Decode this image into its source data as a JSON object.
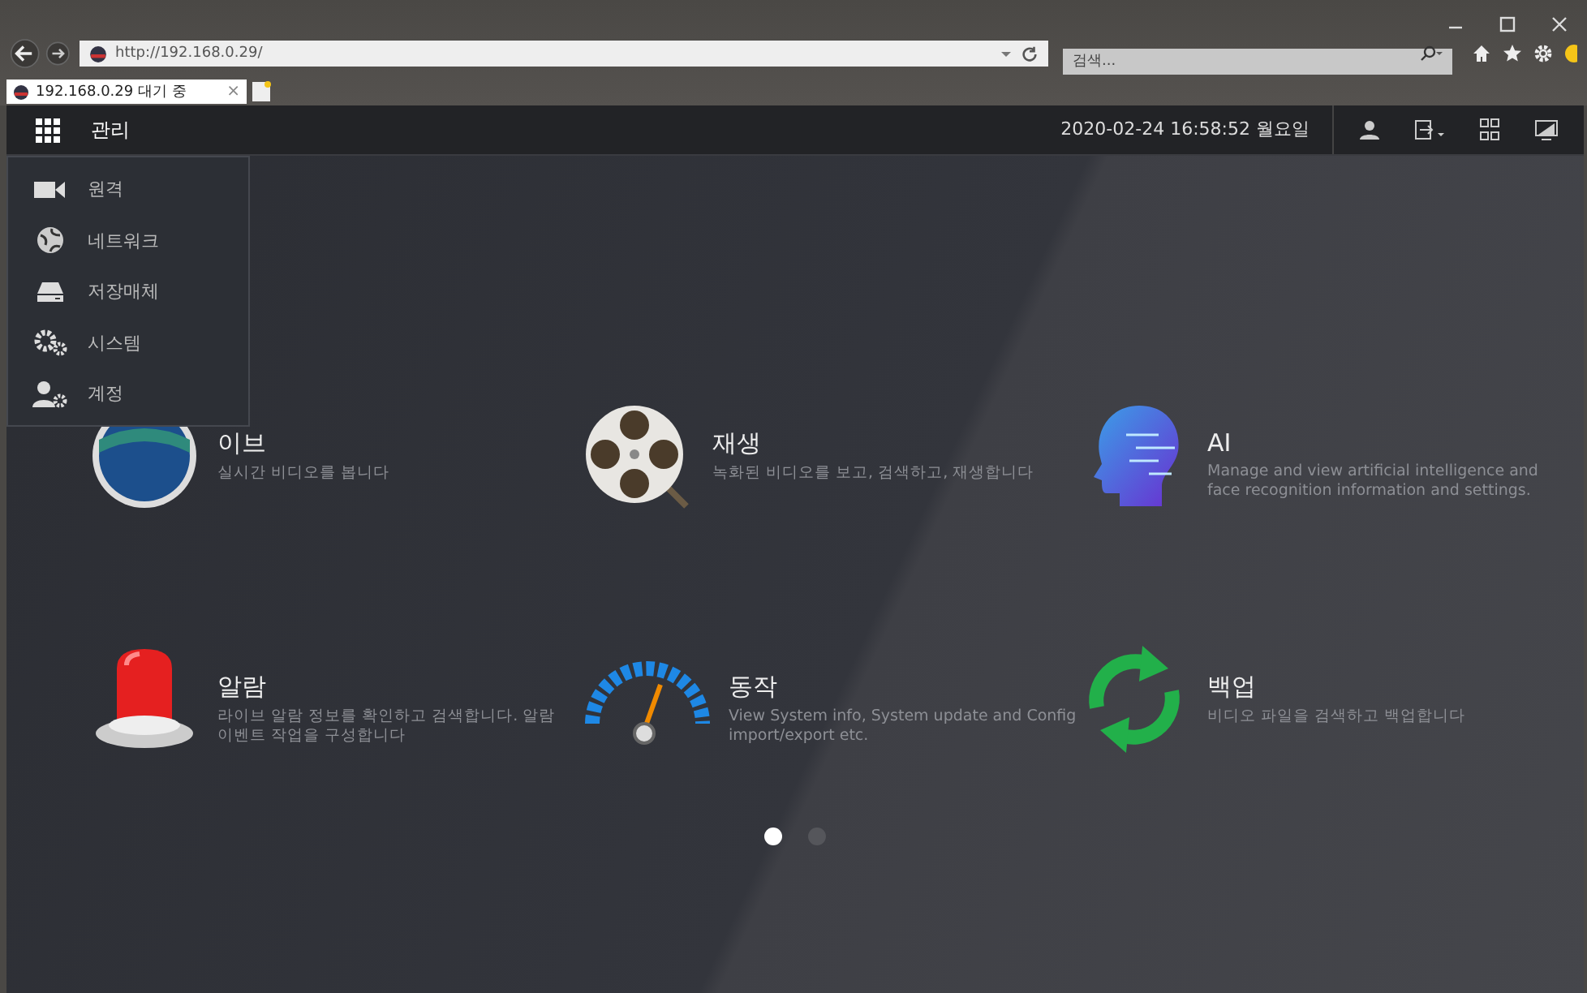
{
  "browser": {
    "url": "http://192.168.0.29/",
    "search": {
      "placeholder": "검색..."
    },
    "tab": {
      "title": "192.168.0.29 대기 중",
      "close": "×"
    }
  },
  "header": {
    "title": "관리",
    "datetime": "2020-02-24 16:58:52 월요일"
  },
  "menu": [
    {
      "label": "원격",
      "kind": "camera"
    },
    {
      "label": "네트워크",
      "kind": "network"
    },
    {
      "label": "저장매체",
      "kind": "storage"
    },
    {
      "label": "시스템",
      "kind": "system"
    },
    {
      "label": "계정",
      "kind": "account"
    }
  ],
  "tiles": [
    {
      "title": "이브",
      "description": "실시간 비디오를 봅니다",
      "kind": "live"
    },
    {
      "title": "재생",
      "description": "녹화된 비디오를 보고, 검색하고, 재생합니다",
      "kind": "playback"
    },
    {
      "title": "AI",
      "description": "Manage and view artificial intelligence and face recognition information and settings.",
      "kind": "ai"
    },
    {
      "title": "알람",
      "description": "라이브 알람 정보를 확인하고 검색합니다. 알람 이벤트 작업을 구성합니다",
      "kind": "alarm"
    },
    {
      "title": "동작",
      "description": "View System info, System update and Config import/export etc.",
      "kind": "gauge"
    },
    {
      "title": "백업",
      "description": "비디오 파일을 검색하고 백업합니다",
      "kind": "backup"
    }
  ],
  "pager": [
    {
      "selected": true
    },
    {
      "selected": false
    }
  ]
}
